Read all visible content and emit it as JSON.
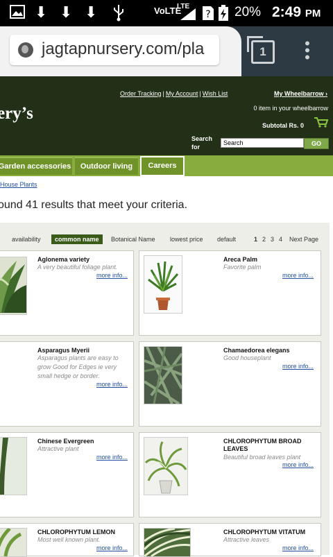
{
  "status_bar": {
    "network": "VoLTE",
    "signal": "LTE",
    "battery": "20%",
    "time": "2:49",
    "ampm": "PM"
  },
  "browser": {
    "url": "jagtapnursery.com/pla",
    "tab_count": "1"
  },
  "header": {
    "logo": "ery’s",
    "links": [
      "Order Tracking",
      "My Account",
      "Wish List"
    ],
    "wheelbarrow": "My Wheelbarrow ›",
    "items_text": "0 item in your wheelbarrow",
    "subtotal": "Subtotal Rs. 0",
    "search_label": "Search for",
    "search_value": "Search",
    "go": "GO"
  },
  "nav": {
    "items": [
      "Garden accessories",
      "Outdoor living",
      "Careers"
    ]
  },
  "breadcrumb": "House Plants",
  "results_text": "ound 41 results that meet your criteria.",
  "sort": {
    "options": [
      "availability",
      "common name",
      "Botanical Name",
      "lowest price",
      "default"
    ],
    "active": "common name",
    "pages": [
      "1",
      "2",
      "3",
      "4"
    ],
    "next": "Next Page"
  },
  "products": [
    {
      "name": "Aglonema variety",
      "desc": "A very beautiful foliage plant.",
      "more": "more info..."
    },
    {
      "name": "Areca Palm",
      "desc": "Favorite palm",
      "more": "more info..."
    },
    {
      "name": "Asparagus Myerii",
      "desc": "Asparagus plants are easy to grow Good for Edges ie very small hedge or border.",
      "more": "more info..."
    },
    {
      "name": "Chamaedorea elegans",
      "desc": "Good houseplant",
      "more": "more info..."
    },
    {
      "name": "Chinese Evergreen",
      "desc": "Attractive plant",
      "more": "more info..."
    },
    {
      "name": "CHLOROPHYTUM BROAD LEAVES",
      "desc": "Beautiful broad leaves plant",
      "more": "more info..."
    },
    {
      "name": "CHLOROPHYTUM LEMON",
      "desc": "Most well known plant.",
      "more": "more info..."
    },
    {
      "name": "CHLOROPHYTUM VITATUM",
      "desc": "Attractive leaves",
      "more": "more info..."
    }
  ]
}
